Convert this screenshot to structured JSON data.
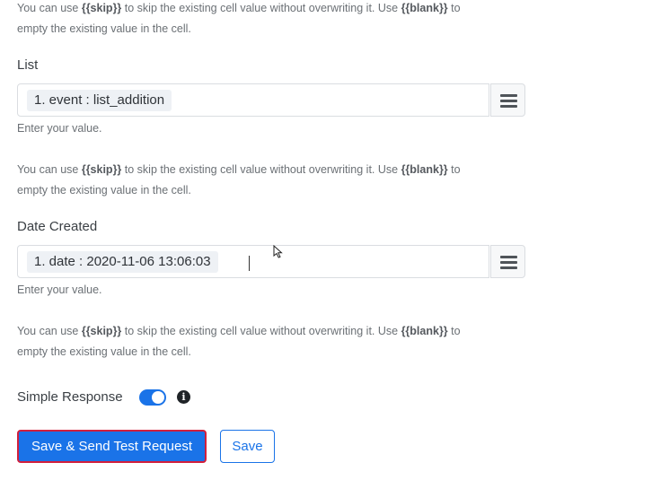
{
  "help_text": {
    "part1": "You can use ",
    "skip_token": "{{skip}}",
    "part2": " to skip the existing cell value without overwriting it. Use ",
    "blank_token": "{{blank}}",
    "part3": " to empty the existing value in the cell."
  },
  "fields": {
    "list": {
      "label": "List",
      "value": "1. event : list_addition",
      "hint": "Enter your value."
    },
    "date_created": {
      "label": "Date Created",
      "value": "1. date : 2020-11-06 13:06:03",
      "hint": "Enter your value."
    }
  },
  "simple_response": {
    "label": "Simple Response",
    "enabled": true,
    "info_icon": "i"
  },
  "buttons": {
    "save_send": "Save & Send Test Request",
    "save": "Save"
  },
  "colors": {
    "accent": "#1a73e8",
    "highlight_border": "#d21f3c"
  }
}
